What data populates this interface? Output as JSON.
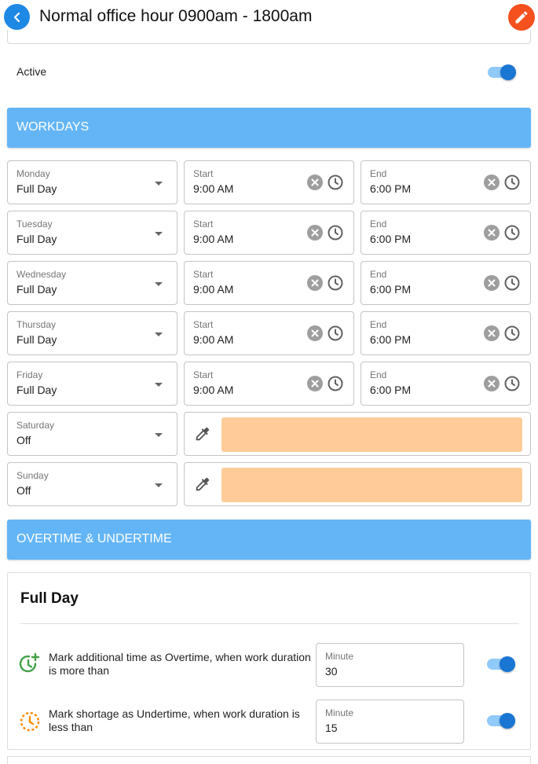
{
  "header": {
    "title": "Normal office hour 0900am - 1800am"
  },
  "active": {
    "label": "Active",
    "on": true
  },
  "workdays": {
    "heading": "WORKDAYS",
    "days": [
      {
        "day": "Monday",
        "type": "Full Day",
        "start_label": "Start",
        "start": "9:00 AM",
        "end_label": "End",
        "end": "6:00 PM",
        "off": false
      },
      {
        "day": "Tuesday",
        "type": "Full Day",
        "start_label": "Start",
        "start": "9:00 AM",
        "end_label": "End",
        "end": "6:00 PM",
        "off": false
      },
      {
        "day": "Wednesday",
        "type": "Full Day",
        "start_label": "Start",
        "start": "9:00 AM",
        "end_label": "End",
        "end": "6:00 PM",
        "off": false
      },
      {
        "day": "Thursday",
        "type": "Full Day",
        "start_label": "Start",
        "start": "9:00 AM",
        "end_label": "End",
        "end": "6:00 PM",
        "off": false
      },
      {
        "day": "Friday",
        "type": "Full Day",
        "start_label": "Start",
        "start": "9:00 AM",
        "end_label": "End",
        "end": "6:00 PM",
        "off": false
      },
      {
        "day": "Saturday",
        "type": "Off",
        "off": true,
        "color": "#ffcc99"
      },
      {
        "day": "Sunday",
        "type": "Off",
        "off": true,
        "color": "#ffcc99"
      }
    ]
  },
  "overtime": {
    "heading": "OVERTIME & UNDERTIME",
    "card_title": "Full Day",
    "rules": [
      {
        "icon": "clock-plus-icon",
        "text": "Mark additional time as Overtime, when work duration is more than",
        "field_label": "Minute",
        "value": "30",
        "on": true
      },
      {
        "icon": "clock-dashed-icon",
        "text": "Mark shortage as Undertime, when work duration is less than",
        "field_label": "Minute",
        "value": "15",
        "on": true
      }
    ]
  },
  "colors": {
    "accent": "#1e88e5",
    "section": "#64b5f6",
    "edit": "#f4511e",
    "off_swatch": "#ffcc99",
    "overtime_icon": "#43a047",
    "undertime_icon": "#fb8c00"
  }
}
